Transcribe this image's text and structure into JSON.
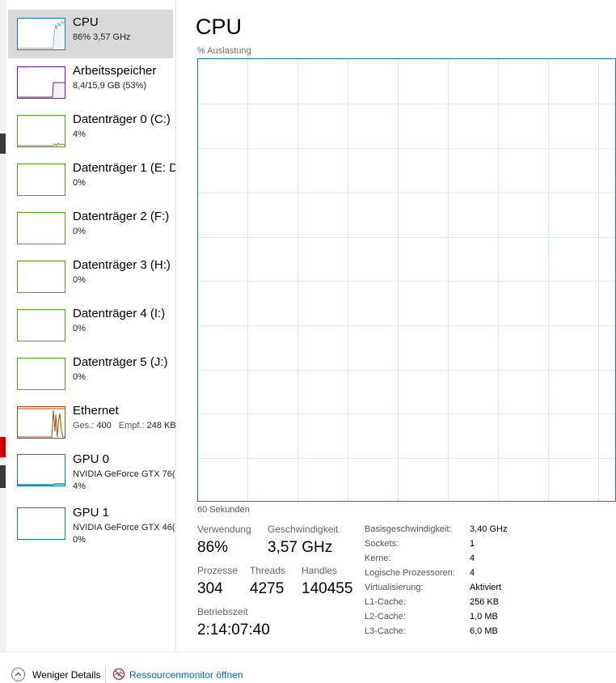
{
  "sidebar": {
    "items": [
      {
        "title": "CPU",
        "sub": "86% 3,57 GHz"
      },
      {
        "title": "Arbeitsspeicher",
        "sub": "8,4/15,9 GB (53%)"
      },
      {
        "title": "Datenträger 0 (C:)",
        "sub": "4%"
      },
      {
        "title": "Datenträger 1 (E: D",
        "sub": "0%"
      },
      {
        "title": "Datenträger 2 (F:)",
        "sub": "0%"
      },
      {
        "title": "Datenträger 3 (H:)",
        "sub": "0%"
      },
      {
        "title": "Datenträger 4 (I:)",
        "sub": "0%"
      },
      {
        "title": "Datenträger 5 (J:)",
        "sub": "0%"
      },
      {
        "title": "Ethernet",
        "send_label": "Ges.:",
        "send_value": "400",
        "recv_label": "Empf.:",
        "recv_value": "248 KBi"
      },
      {
        "title": "GPU 0",
        "sub": "NVIDIA GeForce GTX 76(",
        "sub2": "4%"
      },
      {
        "title": "GPU 1",
        "sub": "NVIDIA GeForce GTX 46(",
        "sub2": "0%"
      }
    ]
  },
  "main": {
    "title": "CPU",
    "graph_label": "% Auslastung",
    "time_label": "60 Sekunden",
    "stats": {
      "verwendung_label": "Verwendung",
      "verwendung": "86%",
      "geschwindigkeit_label": "Geschwindigkeit",
      "geschwindigkeit": "3,57 GHz",
      "prozesse_label": "Prozesse",
      "prozesse": "304",
      "threads_label": "Threads",
      "threads": "4275",
      "handles_label": "Handles",
      "handles": "140455",
      "betriebszeit_label": "Betriebszeit",
      "betriebszeit": "2:14:07:40"
    },
    "specs": [
      {
        "label": "Basisgeschwindigkeit:",
        "value": "3,40 GHz"
      },
      {
        "label": "Sockets:",
        "value": "1"
      },
      {
        "label": "Kerne:",
        "value": "4"
      },
      {
        "label": "Logische Prozessoren:",
        "value": "4"
      },
      {
        "label": "Virtualisierung:",
        "value": "Aktiviert"
      },
      {
        "label": "L1-Cache:",
        "value": "256 KB"
      },
      {
        "label": "L2-Cache:",
        "value": "1,0 MB"
      },
      {
        "label": "L3-Cache:",
        "value": "6,0 MB"
      }
    ]
  },
  "footer": {
    "less_details": "Weniger Details",
    "resource_monitor": "Ressourcenmonitor öffnen"
  },
  "colors": {
    "cpu": "#117dbb",
    "memory": "#8b12ae",
    "disk": "#4da60c",
    "ethernet": "#a74f01",
    "gpu": "#0e7abf",
    "grid": "#d9eaf4"
  },
  "icons": [
    "chevron-up-icon",
    "resource-monitor-icon"
  ]
}
